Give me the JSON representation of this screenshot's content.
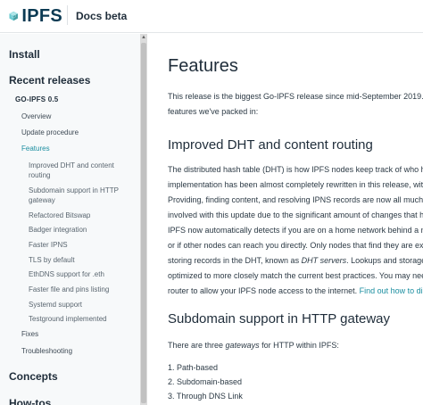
{
  "header": {
    "logo_text": "IPFS",
    "docs_label": "Docs beta"
  },
  "sidebar": {
    "install": "Install",
    "recent_releases": "Recent releases",
    "go_ipfs": "GO-IPFS 0.5",
    "overview": "Overview",
    "update_procedure": "Update procedure",
    "features": "Features",
    "features_children": [
      "Improved DHT and content",
      "routing",
      "Subdomain support in HTTP",
      "gateway",
      "Refactored Bitswap",
      "Badger integration",
      "Faster IPNS",
      "TLS by default",
      "EthDNS support for .eth",
      "Faster file and pins listing",
      "Systemd support",
      "Testground implemented"
    ],
    "fixes": "Fixes",
    "troubleshooting": "Troubleshooting",
    "concepts": "Concepts",
    "how_tos": "How-tos"
  },
  "main": {
    "title": "Features",
    "intro_line1": "This release is the biggest Go-IPFS release since mid-September 2019. Here",
    "intro_line2": "features we've packed in:",
    "h2_dht": "Improved DHT and content routing",
    "dht_p1": [
      "The distributed hash table (DHT) is how IPFS nodes keep track of who has",
      "implementation has been almost completely rewritten in this release, with",
      "Providing, finding content, and resolving IPNS records are now all much fa",
      "involved with this update due to the significant amount of changes that h"
    ],
    "dht_p2_line1": "IPFS now automatically detects if you are on a home network behind a ne",
    "dht_p2_line2": "or if other nodes can reach you directly. Only nodes that find they are ext",
    "dht_p2_line3_pre": "storing records in the DHT, known as ",
    "dht_p2_line3_em": "DHT servers",
    "dht_p2_line3_post": ". Lookups and storage in",
    "dht_p2_line4": "optimized to more closely match the current best practices. You may nee",
    "dht_p2_line5_pre": "router to allow your IPFS node access to the internet. ",
    "dht_p2_line5_link": "Find out how to dis",
    "h2_subdomain": "Subdomain support in HTTP gateway",
    "gateways_pre": "There are three ",
    "gateways_em": "gateways",
    "gateways_post": " for HTTP within IPFS:",
    "gateway_list": [
      "1. Path-based",
      "2. Subdomain-based",
      "3. Through DNS Link"
    ]
  },
  "colors": {
    "accent": "#1b8ea0",
    "sidebar_bg": "#f7f9fa",
    "text": "#1f2d3a"
  },
  "icons": {
    "logo": "ipfs-cube-icon",
    "scroll_up": "scroll-up-arrow-icon"
  }
}
